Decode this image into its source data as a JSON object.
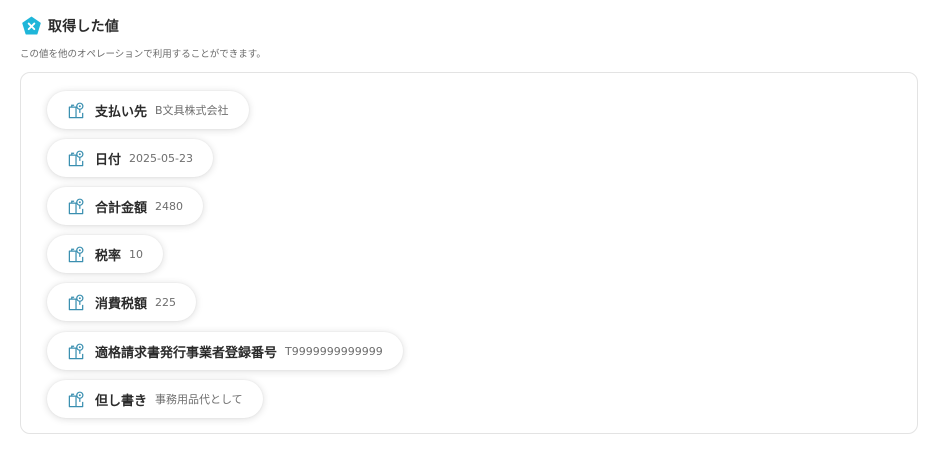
{
  "header": {
    "title": "取得した値",
    "icon": "yoom-x-badge-icon",
    "accent_color": "#1fb6d9"
  },
  "subtitle": "この値を他のオペレーションで利用することができます。",
  "fields": [
    {
      "label": "支払い先",
      "value": "B文具株式会社"
    },
    {
      "label": "日付",
      "value": "2025-05-23"
    },
    {
      "label": "合計金額",
      "value": "2480"
    },
    {
      "label": "税率",
      "value": "10"
    },
    {
      "label": "消費税額",
      "value": "225"
    },
    {
      "label": "適格請求書発行事業者登録番号",
      "value": "T9999999999999"
    },
    {
      "label": "但し書き",
      "value": "事務用品代として"
    }
  ],
  "field_icon": "book-hint-icon",
  "icon_color": "#3a8fb0"
}
